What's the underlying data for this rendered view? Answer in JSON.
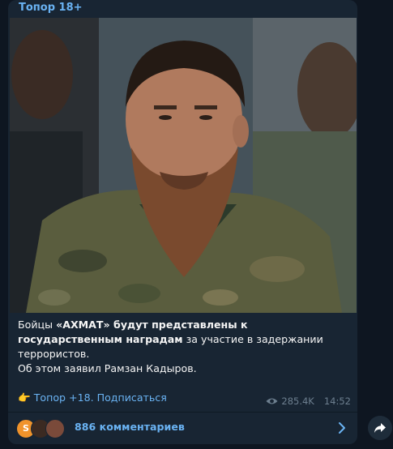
{
  "message": {
    "channel_name": "Топор 18+",
    "photo": {
      "icon": "portrait-photo"
    },
    "caption": {
      "p1_a": "Бойцы ",
      "p1_b": "«АХМАТ» будут представлены к государственным наградам",
      "p1_c": " за участие в задержании террористов.",
      "p2": "Об этом заявил Рамзан Кадыров."
    },
    "link": {
      "emoji": "👉",
      "text": "Топор +18. Подписаться"
    },
    "views": "285.4K",
    "time": "14:52",
    "comments": {
      "avatar_initial": "S",
      "label": "886 комментариев"
    }
  },
  "colors": {
    "background": "#0e1621",
    "bubble": "#182533",
    "accent": "#6ab3f3",
    "meta": "#6d7f8f",
    "text": "#f5f5f5"
  }
}
